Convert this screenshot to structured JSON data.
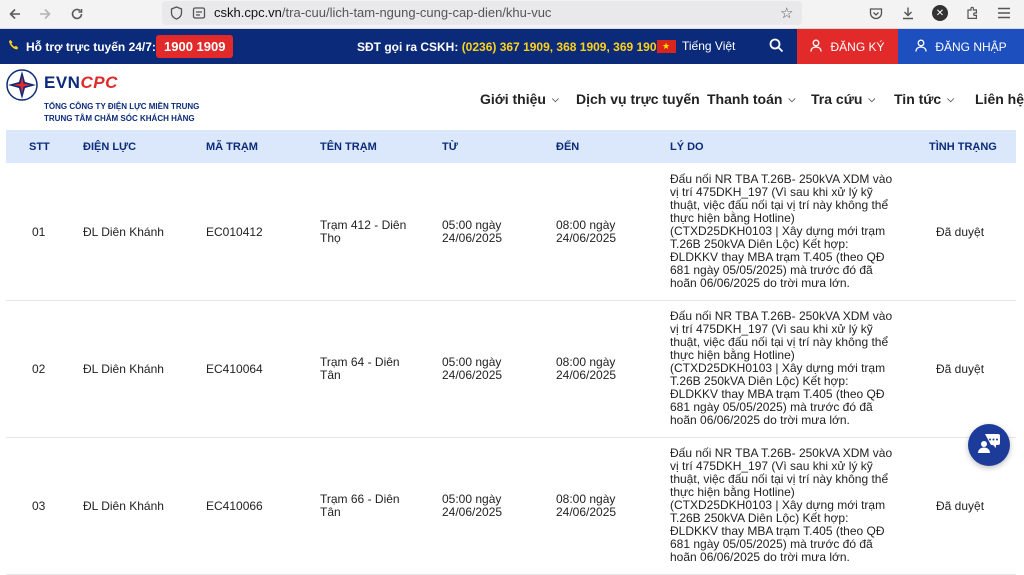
{
  "browser": {
    "url_host": "cskh.cpc.vn",
    "url_path": "/tra-cuu/lich-tam-ngung-cung-cap-dien/khu-vuc"
  },
  "topbar": {
    "hotline_label": "Hỗ trợ trực tuyến 24/7:",
    "hotline_number": "1900 1909",
    "sdt_label": "SĐT gọi ra CSKH:",
    "sdt_numbers": "(0236) 367 1909, 368 1909, 369 1909",
    "language": "Tiếng Việt",
    "register": "ĐĂNG KÝ",
    "login": "ĐĂNG NHẬP"
  },
  "logo": {
    "brand_evn": "EVN",
    "brand_cpc": "CPC",
    "line1": "TỔNG CÔNG TY ĐIỆN LỰC MIỀN TRUNG",
    "line2": "TRUNG TÂM CHĂM SÓC KHÁCH HÀNG"
  },
  "menu": [
    {
      "label": "Giới thiệu",
      "has_dropdown": true
    },
    {
      "label": "Dịch vụ trực tuyến",
      "has_dropdown": false
    },
    {
      "label": "Thanh toán",
      "has_dropdown": true
    },
    {
      "label": "Tra cứu",
      "has_dropdown": true
    },
    {
      "label": "Tin tức",
      "has_dropdown": true
    },
    {
      "label": "Liên hệ",
      "has_dropdown": false
    }
  ],
  "table": {
    "headers": [
      "STT",
      "ĐIỆN LỰC",
      "MÃ TRẠM",
      "TÊN TRẠM",
      "TỪ",
      "ĐẾN",
      "LÝ DO",
      "TÌNH TRẠNG"
    ],
    "rows": [
      {
        "stt": "01",
        "dien_luc": "ĐL Diên Khánh",
        "ma_tram": "EC010412",
        "ten_tram": "Trạm 412 - Diên Thọ",
        "tu": "05:00 ngày 24/06/2025",
        "den": "08:00 ngày 24/06/2025",
        "ly_do": "Đấu nối NR TBA T.26B- 250kVA XDM vào vị trí 475DKH_197 (Vì sau khi xử lý kỹ thuật, việc đấu nối tại vị trí này không thể thực hiện bằng Hotline) (CTXD25DKH0103 | Xây dựng mới trạm T.26B 250kVA Diên Lộc) Kết hợp: ĐLDKKV thay MBA trạm T.405 (theo QĐ 681 ngày 05/05/2025) mà trước đó đã hoãn 06/06/2025 do trời mưa lớn.",
        "tinh_trang": "Đã duyệt"
      },
      {
        "stt": "02",
        "dien_luc": "ĐL Diên Khánh",
        "ma_tram": "EC410064",
        "ten_tram": "Trạm 64 - Diên Tân",
        "tu": "05:00 ngày 24/06/2025",
        "den": "08:00 ngày 24/06/2025",
        "ly_do": "Đấu nối NR TBA T.26B- 250kVA XDM vào vị trí 475DKH_197 (Vì sau khi xử lý kỹ thuật, việc đấu nối tại vị trí này không thể thực hiện bằng Hotline) (CTXD25DKH0103 | Xây dựng mới trạm T.26B 250kVA Diên Lộc) Kết hợp: ĐLDKKV thay MBA trạm T.405 (theo QĐ 681 ngày 05/05/2025) mà trước đó đã hoãn 06/06/2025 do trời mưa lớn.",
        "tinh_trang": "Đã duyệt"
      },
      {
        "stt": "03",
        "dien_luc": "ĐL Diên Khánh",
        "ma_tram": "EC410066",
        "ten_tram": "Trạm 66 - Diên Tân",
        "tu": "05:00 ngày 24/06/2025",
        "den": "08:00 ngày 24/06/2025",
        "ly_do": "Đấu nối NR TBA T.26B- 250kVA XDM vào vị trí 475DKH_197 (Vì sau khi xử lý kỹ thuật, việc đấu nối tại vị trí này không thể thực hiện bằng Hotline) (CTXD25DKH0103 | Xây dựng mới trạm T.26B 250kVA Diên Lộc) Kết hợp: ĐLDKKV thay MBA trạm T.405 (theo QĐ 681 ngày 05/05/2025) mà trước đó đã hoãn 06/06/2025 do trời mưa lớn.",
        "tinh_trang": "Đã duyệt"
      }
    ]
  },
  "colors": {
    "navy": "#0b2b7a",
    "red": "#e22a2a",
    "blue": "#1d4fbf",
    "header_bg": "#dbe8fb",
    "hotline_yellow": "#ffd21a"
  }
}
